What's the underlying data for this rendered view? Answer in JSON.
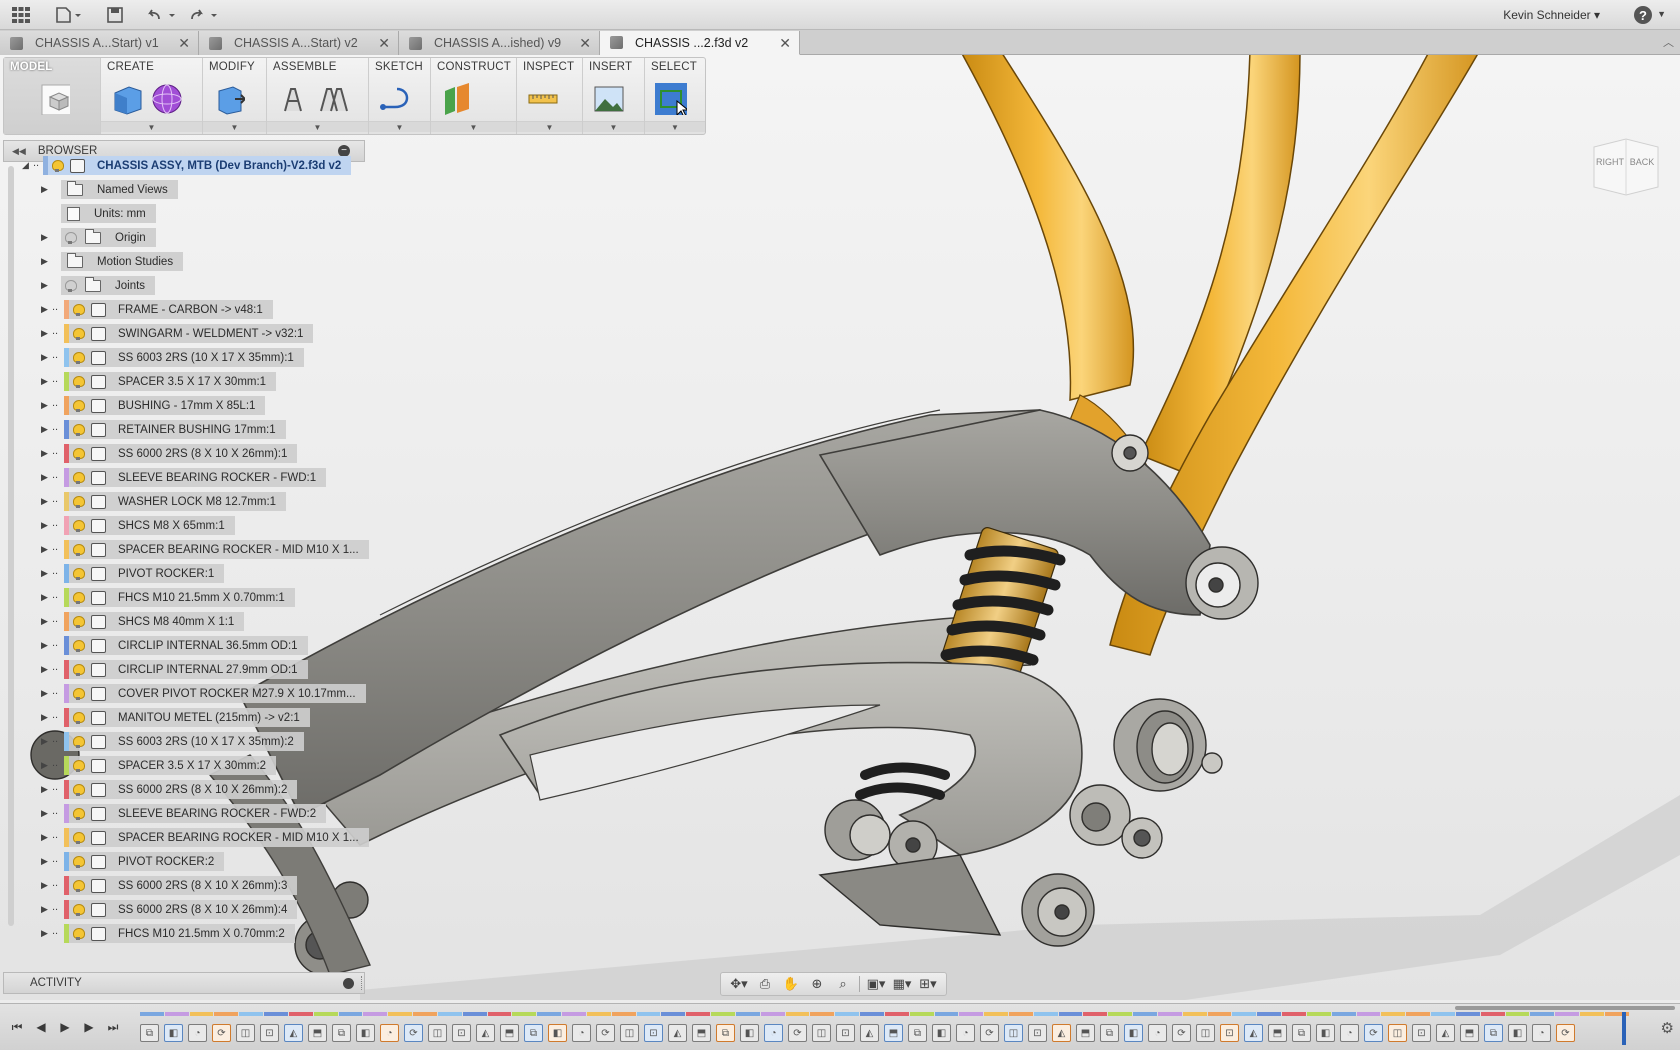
{
  "topbar": {
    "user": "Kevin Schneider",
    "help": "?"
  },
  "tabs": [
    {
      "label": "CHASSIS A...Start) v1",
      "active": false
    },
    {
      "label": "CHASSIS A...Start) v2",
      "active": false
    },
    {
      "label": "CHASSIS A...ished) v9",
      "active": false
    },
    {
      "label": "CHASSIS ...2.f3d v2",
      "active": true
    }
  ],
  "toolbar": {
    "workspace": "MODEL",
    "groups": [
      "CREATE",
      "MODIFY",
      "ASSEMBLE",
      "SKETCH",
      "CONSTRUCT",
      "INSPECT",
      "INSERT",
      "SELECT"
    ]
  },
  "browser": {
    "title": "BROWSER",
    "root": "CHASSIS ASSY, MTB (Dev Branch)-V2.f3d v2",
    "folders": [
      {
        "label": "Named Views",
        "bulb": false,
        "expander": true
      },
      {
        "label": "Units: mm",
        "bulb": false,
        "expander": false
      },
      {
        "label": "Origin",
        "bulb": "off",
        "expander": true
      },
      {
        "label": "Motion Studies",
        "bulb": false,
        "expander": true
      },
      {
        "label": "Joints",
        "bulb": "off",
        "expander": true
      }
    ],
    "components": [
      {
        "label": "FRAME - CARBON -> v48:1",
        "color": "#f2a97a"
      },
      {
        "label": "SWINGARM - WELDMENT -> v32:1",
        "color": "#f2c05a"
      },
      {
        "label": "SS 6003 2RS (10 X 17 X 35mm):1",
        "color": "#8fc3ee"
      },
      {
        "label": "SPACER 3.5 X 17 X 30mm:1",
        "color": "#b6d95a"
      },
      {
        "label": "BUSHING - 17mm X 85L:1",
        "color": "#f0a35e"
      },
      {
        "label": "RETAINER BUSHING 17mm:1",
        "color": "#6a8fd8"
      },
      {
        "label": "SS 6000 2RS (8 X 10 X 26mm):1",
        "color": "#e0616a"
      },
      {
        "label": "SLEEVE BEARING ROCKER - FWD:1",
        "color": "#c59be2"
      },
      {
        "label": "WASHER LOCK M8 12.7mm:1",
        "color": "#e9c86a"
      },
      {
        "label": "SHCS M8 X 65mm:1",
        "color": "#f1a2b4"
      },
      {
        "label": "SPACER BEARING ROCKER - MID M10 X 1...",
        "color": "#f2c05a"
      },
      {
        "label": "PIVOT ROCKER:1",
        "color": "#7db3e8"
      },
      {
        "label": "FHCS M10 21.5mm X 0.70mm:1",
        "color": "#b6d95a"
      },
      {
        "label": "SHCS M8 40mm X 1:1",
        "color": "#f0a35e"
      },
      {
        "label": "CIRCLIP INTERNAL 36.5mm OD:1",
        "color": "#6a8fd8"
      },
      {
        "label": "CIRCLIP INTERNAL 27.9mm OD:1",
        "color": "#e0616a"
      },
      {
        "label": "COVER PIVOT ROCKER M27.9 X 10.17mm...",
        "color": "#c59be2"
      },
      {
        "label": "MANITOU METEL (215mm) -> v2:1",
        "color": "#e0616a"
      },
      {
        "label": "SS 6003 2RS (10 X 17 X 35mm):2",
        "color": "#8fc3ee"
      },
      {
        "label": "SPACER 3.5 X 17 X 30mm:2",
        "color": "#b6d95a"
      },
      {
        "label": "SS 6000 2RS (8 X 10 X 26mm):2",
        "color": "#e0616a"
      },
      {
        "label": "SLEEVE BEARING ROCKER - FWD:2",
        "color": "#c59be2"
      },
      {
        "label": "SPACER BEARING ROCKER - MID M10 X 1...",
        "color": "#f2c05a"
      },
      {
        "label": "PIVOT ROCKER:2",
        "color": "#7db3e8"
      },
      {
        "label": "SS 6000 2RS (8 X 10 X 26mm):3",
        "color": "#e0616a"
      },
      {
        "label": "SS 6000 2RS (8 X 10 X 26mm):4",
        "color": "#e0616a"
      },
      {
        "label": "FHCS M10 21.5mm X 0.70mm:2",
        "color": "#b6d95a"
      }
    ]
  },
  "activity": {
    "title": "ACTIVITY"
  },
  "viewcube": {
    "right": "RIGHT",
    "back": "BACK"
  },
  "timeline": {
    "colors": [
      "#7aa7e0",
      "#f0a35e",
      "#e0616a",
      "#c59be2",
      "#8fc3ee",
      "#b6d95a",
      "#f2c05a",
      "#6a8fd8"
    ]
  }
}
